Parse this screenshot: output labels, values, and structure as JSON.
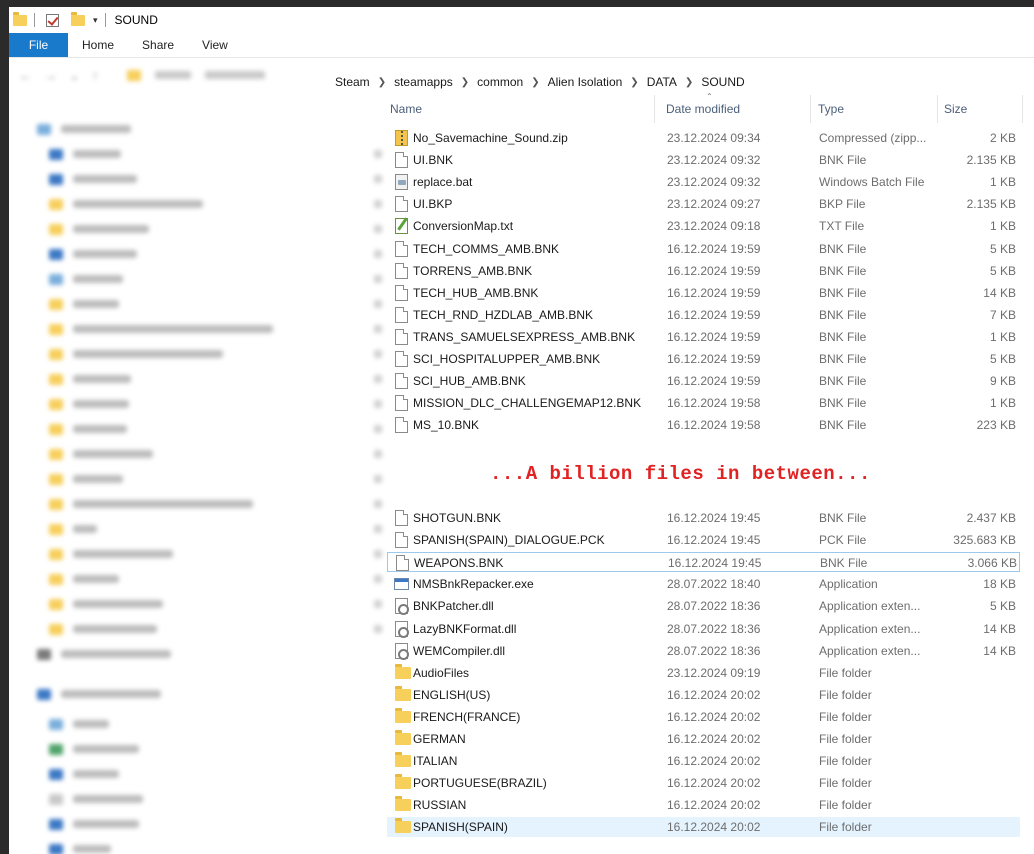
{
  "window": {
    "title": "SOUND"
  },
  "ribbon": {
    "tabs": [
      "File",
      "Home",
      "Share",
      "View"
    ]
  },
  "breadcrumb": [
    "Steam",
    "steamapps",
    "common",
    "Alien Isolation",
    "DATA",
    "SOUND"
  ],
  "columns": {
    "name": "Name",
    "date": "Date modified",
    "type": "Type",
    "size": "Size"
  },
  "annotation": "...A billion files in between...",
  "files_top": [
    {
      "name": "No_Savemachine_Sound.zip",
      "date": "23.12.2024 09:34",
      "type": "Compressed (zipp...",
      "size": "2 KB",
      "icon": "zip"
    },
    {
      "name": "UI.BNK",
      "date": "23.12.2024 09:32",
      "type": "BNK File",
      "size": "2.135 KB",
      "icon": "doc"
    },
    {
      "name": "replace.bat",
      "date": "23.12.2024 09:32",
      "type": "Windows Batch File",
      "size": "1 KB",
      "icon": "bat"
    },
    {
      "name": "UI.BKP",
      "date": "23.12.2024 09:27",
      "type": "BKP File",
      "size": "2.135 KB",
      "icon": "doc"
    },
    {
      "name": "ConversionMap.txt",
      "date": "23.12.2024 09:18",
      "type": "TXT File",
      "size": "1 KB",
      "icon": "txt"
    },
    {
      "name": "TECH_COMMS_AMB.BNK",
      "date": "16.12.2024 19:59",
      "type": "BNK File",
      "size": "5 KB",
      "icon": "doc"
    },
    {
      "name": "TORRENS_AMB.BNK",
      "date": "16.12.2024 19:59",
      "type": "BNK File",
      "size": "5 KB",
      "icon": "doc"
    },
    {
      "name": "TECH_HUB_AMB.BNK",
      "date": "16.12.2024 19:59",
      "type": "BNK File",
      "size": "14 KB",
      "icon": "doc"
    },
    {
      "name": "TECH_RND_HZDLAB_AMB.BNK",
      "date": "16.12.2024 19:59",
      "type": "BNK File",
      "size": "7 KB",
      "icon": "doc"
    },
    {
      "name": "TRANS_SAMUELSEXPRESS_AMB.BNK",
      "date": "16.12.2024 19:59",
      "type": "BNK File",
      "size": "1 KB",
      "icon": "doc"
    },
    {
      "name": "SCI_HOSPITALUPPER_AMB.BNK",
      "date": "16.12.2024 19:59",
      "type": "BNK File",
      "size": "5 KB",
      "icon": "doc"
    },
    {
      "name": "SCI_HUB_AMB.BNK",
      "date": "16.12.2024 19:59",
      "type": "BNK File",
      "size": "9 KB",
      "icon": "doc"
    },
    {
      "name": "MISSION_DLC_CHALLENGEMAP12.BNK",
      "date": "16.12.2024 19:58",
      "type": "BNK File",
      "size": "1 KB",
      "icon": "doc"
    },
    {
      "name": "MS_10.BNK",
      "date": "16.12.2024 19:58",
      "type": "BNK File",
      "size": "223 KB",
      "icon": "doc"
    }
  ],
  "files_bottom": [
    {
      "name": "SHOTGUN.BNK",
      "date": "16.12.2024 19:45",
      "type": "BNK File",
      "size": "2.437 KB",
      "icon": "doc"
    },
    {
      "name": "SPANISH(SPAIN)_DIALOGUE.PCK",
      "date": "16.12.2024 19:45",
      "type": "PCK File",
      "size": "325.683 KB",
      "icon": "doc"
    },
    {
      "name": "WEAPONS.BNK",
      "date": "16.12.2024 19:45",
      "type": "BNK File",
      "size": "3.066 KB",
      "icon": "doc",
      "state": "outline"
    },
    {
      "name": "NMSBnkRepacker.exe",
      "date": "28.07.2022 18:40",
      "type": "Application",
      "size": "18 KB",
      "icon": "exe"
    },
    {
      "name": "BNKPatcher.dll",
      "date": "28.07.2022 18:36",
      "type": "Application exten...",
      "size": "5 KB",
      "icon": "dll"
    },
    {
      "name": "LazyBNKFormat.dll",
      "date": "28.07.2022 18:36",
      "type": "Application exten...",
      "size": "14 KB",
      "icon": "dll"
    },
    {
      "name": "WEMCompiler.dll",
      "date": "28.07.2022 18:36",
      "type": "Application exten...",
      "size": "14 KB",
      "icon": "dll"
    },
    {
      "name": "AudioFiles",
      "date": "23.12.2024 09:19",
      "type": "File folder",
      "size": "",
      "icon": "folder"
    },
    {
      "name": "ENGLISH(US)",
      "date": "16.12.2024 20:02",
      "type": "File folder",
      "size": "",
      "icon": "folder"
    },
    {
      "name": "FRENCH(FRANCE)",
      "date": "16.12.2024 20:02",
      "type": "File folder",
      "size": "",
      "icon": "folder"
    },
    {
      "name": "GERMAN",
      "date": "16.12.2024 20:02",
      "type": "File folder",
      "size": "",
      "icon": "folder"
    },
    {
      "name": "ITALIAN",
      "date": "16.12.2024 20:02",
      "type": "File folder",
      "size": "",
      "icon": "folder"
    },
    {
      "name": "PORTUGUESE(BRAZIL)",
      "date": "16.12.2024 20:02",
      "type": "File folder",
      "size": "",
      "icon": "folder"
    },
    {
      "name": "RUSSIAN",
      "date": "16.12.2024 20:02",
      "type": "File folder",
      "size": "",
      "icon": "folder"
    },
    {
      "name": "SPANISH(SPAIN)",
      "date": "16.12.2024 20:02",
      "type": "File folder",
      "size": "",
      "icon": "folder",
      "state": "selected"
    }
  ]
}
